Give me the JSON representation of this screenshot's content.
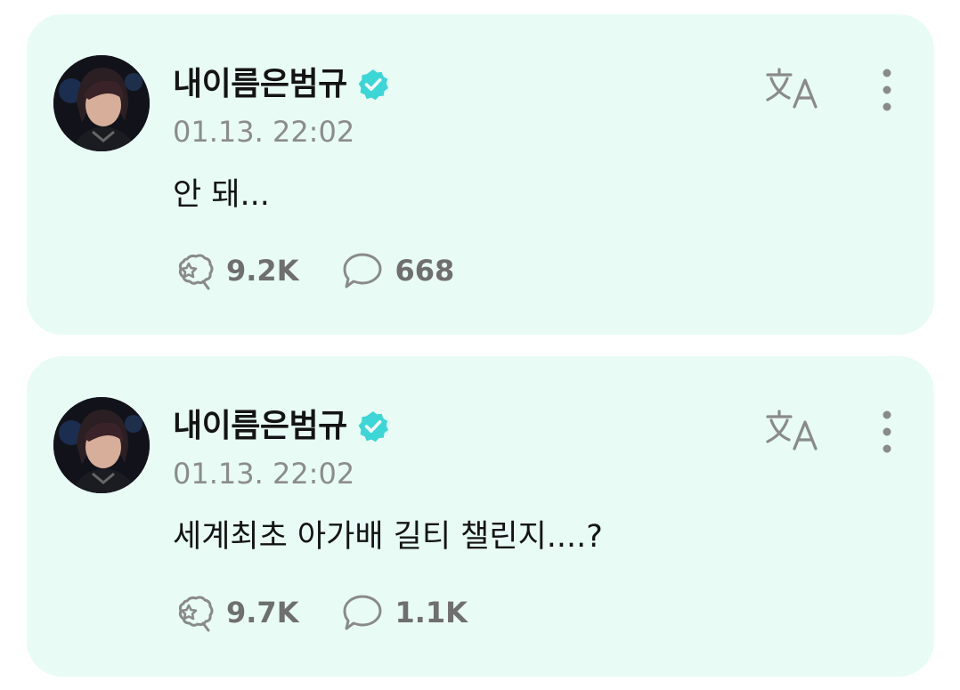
{
  "posts": [
    {
      "author": "내이름은범규",
      "timestamp": "01.13. 22:02",
      "text": "안 돼...",
      "likes": "9.2K",
      "comments": "668"
    },
    {
      "author": "내이름은범규",
      "timestamp": "01.13. 22:02",
      "text": "세계최초 아가배 길티 챌린지....?",
      "likes": "9.7K",
      "comments": "1.1K"
    }
  ],
  "icons": {
    "verified": "verified-badge-icon",
    "translate": "translate-icon",
    "more": "more-vertical-icon",
    "cheer": "cheer-icon",
    "comment": "comment-bubble-icon"
  },
  "colors": {
    "card_background": "#e8fbf5",
    "verified_badge": "#3cd6d6",
    "author_text": "#141414",
    "muted_text": "#8c8c8c",
    "icon_gray": "#8a8a8a"
  }
}
